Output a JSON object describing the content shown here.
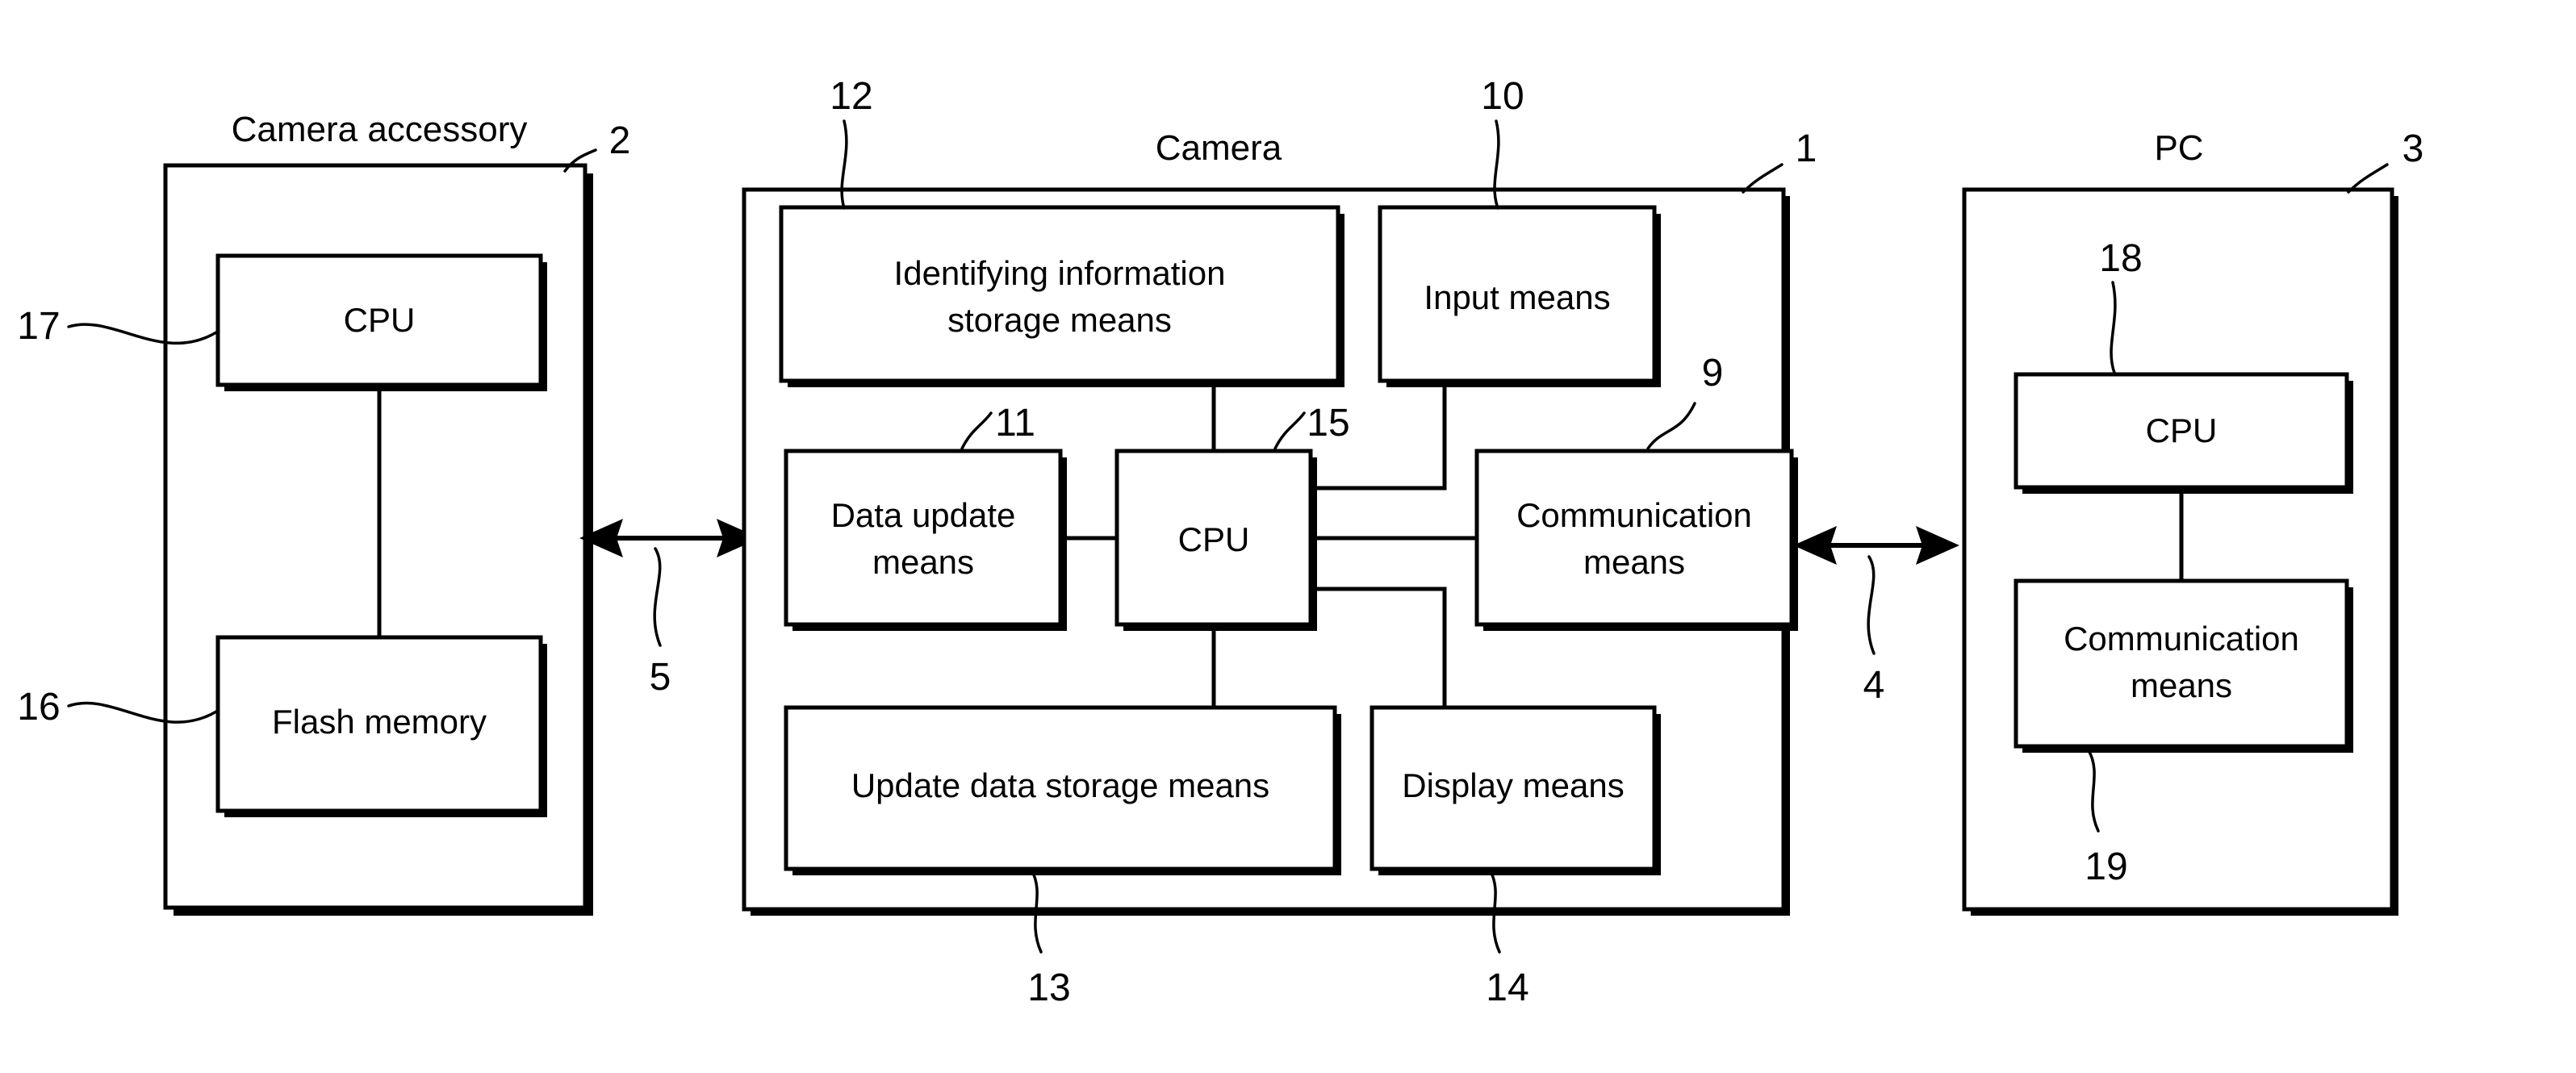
{
  "figure": {
    "type": "patent-block-diagram",
    "background_color": "#ffffff",
    "line_color": "#000000"
  },
  "panels": [
    {
      "id": "camera-accessory",
      "title": "Camera accessory",
      "ref": "2",
      "blocks": [
        {
          "id": "accessory-cpu",
          "label": "CPU",
          "ref": "17"
        },
        {
          "id": "accessory-flash",
          "label": "Flash memory",
          "ref": "16"
        }
      ]
    },
    {
      "id": "camera",
      "title": "Camera",
      "ref": "1",
      "blocks": [
        {
          "id": "identifying-info-storage",
          "label_line1": "Identifying information",
          "label_line2": "storage means",
          "ref": "12"
        },
        {
          "id": "input-means",
          "label": "Input means",
          "ref": "10"
        },
        {
          "id": "data-update-means",
          "label_line1": "Data update",
          "label_line2": "means",
          "ref": "11"
        },
        {
          "id": "camera-cpu",
          "label": "CPU",
          "ref": "15"
        },
        {
          "id": "camera-communication-means",
          "label_line1": "Communication",
          "label_line2": "means",
          "ref": "9"
        },
        {
          "id": "update-data-storage-means",
          "label": "Update data storage means",
          "ref": "13"
        },
        {
          "id": "display-means",
          "label": "Display means",
          "ref": "14"
        }
      ]
    },
    {
      "id": "pc",
      "title": "PC",
      "ref": "3",
      "blocks": [
        {
          "id": "pc-cpu",
          "label": "CPU",
          "ref": "18"
        },
        {
          "id": "pc-communication-means",
          "label_line1": "Communication",
          "label_line2": "means",
          "ref": "19"
        }
      ]
    }
  ],
  "connectors": [
    {
      "id": "accessory-camera-link",
      "ref": "5",
      "style": "double-arrow",
      "from": "camera-accessory",
      "to": "camera"
    },
    {
      "id": "camera-pc-link",
      "ref": "4",
      "style": "double-arrow",
      "from": "camera",
      "to": "pc"
    }
  ],
  "labels": {
    "camera_accessory_title": "Camera accessory",
    "camera_title": "Camera",
    "pc_title": "PC",
    "accessory_cpu": "CPU",
    "accessory_flash": "Flash memory",
    "identifying_info_l1": "Identifying information",
    "identifying_info_l2": "storage means",
    "input_means": "Input means",
    "data_update_l1": "Data update",
    "data_update_l2": "means",
    "camera_cpu": "CPU",
    "camera_comm_l1": "Communication",
    "camera_comm_l2": "means",
    "update_data_storage": "Update data storage means",
    "display_means": "Display means",
    "pc_cpu": "CPU",
    "pc_comm_l1": "Communication",
    "pc_comm_l2": "means"
  },
  "refs": {
    "r1": "1",
    "r2": "2",
    "r3": "3",
    "r4": "4",
    "r5": "5",
    "r9": "9",
    "r10": "10",
    "r11": "11",
    "r12": "12",
    "r13": "13",
    "r14": "14",
    "r15": "15",
    "r16": "16",
    "r17": "17",
    "r18": "18",
    "r19": "19"
  }
}
